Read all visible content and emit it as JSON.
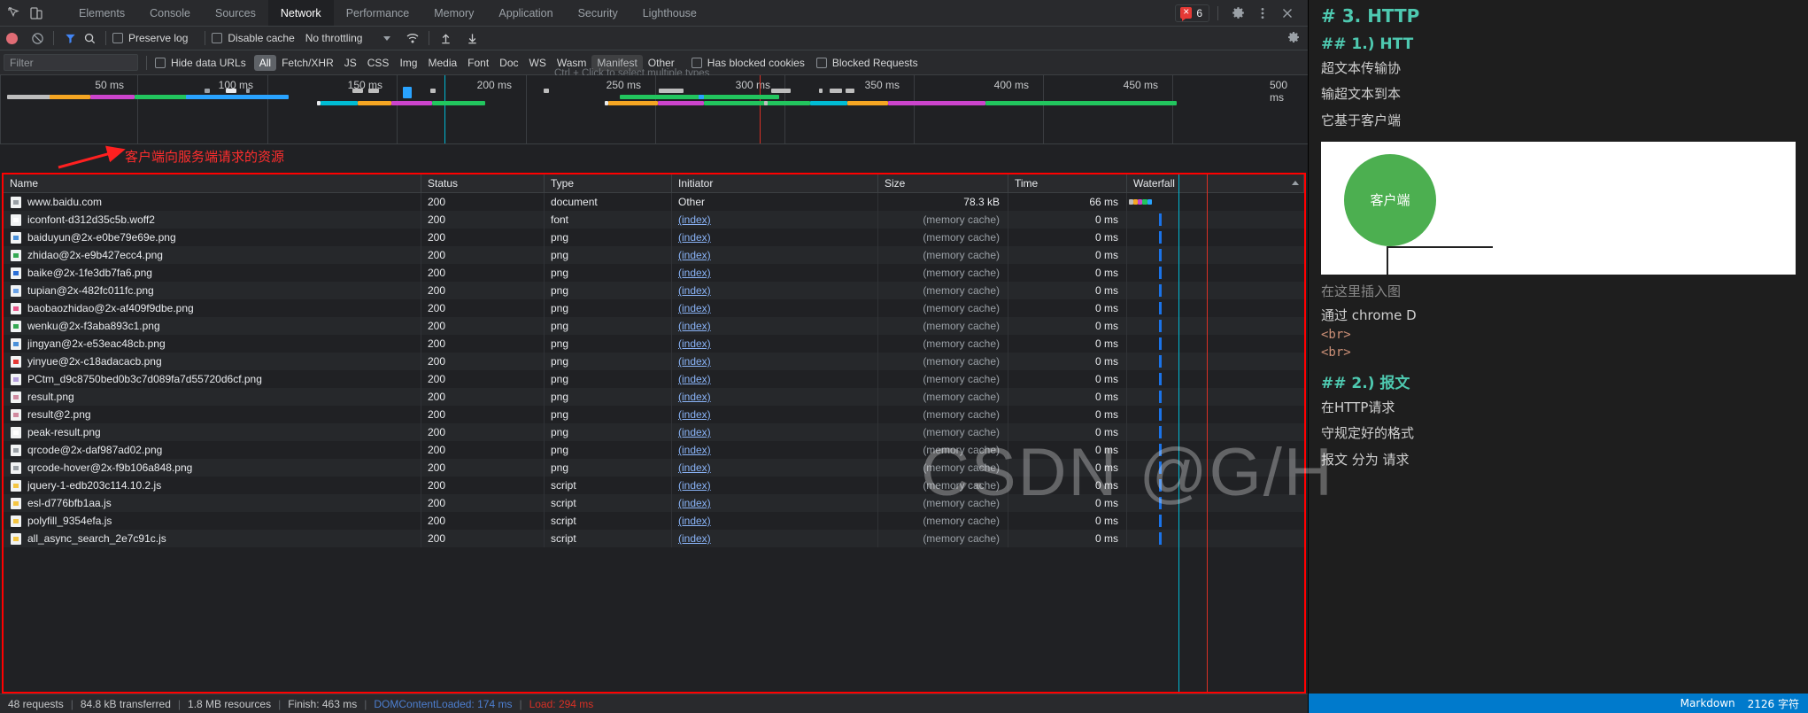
{
  "devtools": {
    "tabs": [
      {
        "label": "Elements",
        "active": false
      },
      {
        "label": "Console",
        "active": false
      },
      {
        "label": "Sources",
        "active": false
      },
      {
        "label": "Network",
        "active": true
      },
      {
        "label": "Performance",
        "active": false
      },
      {
        "label": "Memory",
        "active": false
      },
      {
        "label": "Application",
        "active": false
      },
      {
        "label": "Security",
        "active": false
      },
      {
        "label": "Lighthouse",
        "active": false
      }
    ],
    "error_count": "6",
    "icons": {
      "inspect": "inspect-element-icon",
      "device": "device-toolbar-icon",
      "error": "error-badge-icon",
      "settings": "gear-icon",
      "more": "kebab-menu-icon",
      "close": "close-icon"
    },
    "toolbar": {
      "record_title": "record-button",
      "clear_title": "clear-button",
      "filter_title": "filter-icon",
      "search_title": "search-icon",
      "preserve_log": "Preserve log",
      "disable_cache": "Disable cache",
      "throttling": "No throttling",
      "import_title": "import-har-icon",
      "export_title": "export-har-icon",
      "wifi_title": "network-conditions-icon",
      "settings_title": "network-settings-gear-icon"
    },
    "filterbar": {
      "placeholder": "Filter",
      "filter_value": "",
      "hide_data_urls": "Hide data URLs",
      "types": [
        {
          "label": "All",
          "state": "selected"
        },
        {
          "label": "Fetch/XHR",
          "state": "normal"
        },
        {
          "label": "JS",
          "state": "normal"
        },
        {
          "label": "CSS",
          "state": "normal"
        },
        {
          "label": "Img",
          "state": "normal"
        },
        {
          "label": "Media",
          "state": "normal"
        },
        {
          "label": "Font",
          "state": "normal"
        },
        {
          "label": "Doc",
          "state": "normal"
        },
        {
          "label": "WS",
          "state": "normal"
        },
        {
          "label": "Wasm",
          "state": "normal"
        },
        {
          "label": "Manifest",
          "state": "hover"
        },
        {
          "label": "Other",
          "state": "normal"
        }
      ],
      "has_blocked_cookies": "Has blocked cookies",
      "blocked_requests": "Blocked Requests",
      "tooltip": "Ctrl + Click to select multiple types"
    },
    "overview": {
      "ticks": [
        "50 ms",
        "100 ms",
        "150 ms",
        "200 ms",
        "250 ms",
        "300 ms",
        "350 ms",
        "400 ms",
        "450 ms",
        "500 ms"
      ]
    },
    "annotation": {
      "text": "客户端向服务端请求的资源",
      "color": "#ff2d2d"
    },
    "table": {
      "columns": [
        "Name",
        "Status",
        "Type",
        "Initiator",
        "Size",
        "Time",
        "Waterfall"
      ],
      "rows": [
        {
          "name": "www.baidu.com",
          "icon_color": "#9aa0a6",
          "status": "200",
          "type": "document",
          "initiator": "Other",
          "initiator_link": false,
          "size": "78.3 kB",
          "cached": false,
          "time": "66 ms",
          "wf_start": 2,
          "wf_len": 26,
          "wf_color": "#1a73e8"
        },
        {
          "name": "iconfont-d312d35c5b.woff2",
          "icon_color": "#ffffff",
          "status": "200",
          "type": "font",
          "initiator": "(index)",
          "initiator_link": true,
          "size": "(memory cache)",
          "cached": true,
          "time": "0 ms",
          "wf_start": 36,
          "wf_len": 2,
          "wf_color": "#1a73e8"
        },
        {
          "name": "baiduyun@2x-e0be79e69e.png",
          "icon_color": "#4a90d9",
          "status": "200",
          "type": "png",
          "initiator": "(index)",
          "initiator_link": true,
          "size": "(memory cache)",
          "cached": true,
          "time": "0 ms",
          "wf_start": 36,
          "wf_len": 2,
          "wf_color": "#1a73e8"
        },
        {
          "name": "zhidao@2x-e9b427ecc4.png",
          "icon_color": "#34a853",
          "status": "200",
          "type": "png",
          "initiator": "(index)",
          "initiator_link": true,
          "size": "(memory cache)",
          "cached": true,
          "time": "0 ms",
          "wf_start": 36,
          "wf_len": 2,
          "wf_color": "#1a73e8"
        },
        {
          "name": "baike@2x-1fe3db7fa6.png",
          "icon_color": "#2b6fd6",
          "status": "200",
          "type": "png",
          "initiator": "(index)",
          "initiator_link": true,
          "size": "(memory cache)",
          "cached": true,
          "time": "0 ms",
          "wf_start": 36,
          "wf_len": 2,
          "wf_color": "#1a73e8"
        },
        {
          "name": "tupian@2x-482fc011fc.png",
          "icon_color": "#6ba3e8",
          "status": "200",
          "type": "png",
          "initiator": "(index)",
          "initiator_link": true,
          "size": "(memory cache)",
          "cached": true,
          "time": "0 ms",
          "wf_start": 36,
          "wf_len": 2,
          "wf_color": "#1a73e8"
        },
        {
          "name": "baobaozhidao@2x-af409f9dbe.png",
          "icon_color": "#e8558a",
          "status": "200",
          "type": "png",
          "initiator": "(index)",
          "initiator_link": true,
          "size": "(memory cache)",
          "cached": true,
          "time": "0 ms",
          "wf_start": 36,
          "wf_len": 2,
          "wf_color": "#1a73e8"
        },
        {
          "name": "wenku@2x-f3aba893c1.png",
          "icon_color": "#34a853",
          "status": "200",
          "type": "png",
          "initiator": "(index)",
          "initiator_link": true,
          "size": "(memory cache)",
          "cached": true,
          "time": "0 ms",
          "wf_start": 36,
          "wf_len": 2,
          "wf_color": "#1a73e8"
        },
        {
          "name": "jingyan@2x-e53eac48cb.png",
          "icon_color": "#4a90d9",
          "status": "200",
          "type": "png",
          "initiator": "(index)",
          "initiator_link": true,
          "size": "(memory cache)",
          "cached": true,
          "time": "0 ms",
          "wf_start": 36,
          "wf_len": 2,
          "wf_color": "#1a73e8"
        },
        {
          "name": "yinyue@2x-c18adacacb.png",
          "icon_color": "#e53935",
          "status": "200",
          "type": "png",
          "initiator": "(index)",
          "initiator_link": true,
          "size": "(memory cache)",
          "cached": true,
          "time": "0 ms",
          "wf_start": 36,
          "wf_len": 2,
          "wf_color": "#1a73e8"
        },
        {
          "name": "PCtm_d9c8750bed0b3c7d089fa7d55720d6cf.png",
          "icon_color": "#b39ddb",
          "status": "200",
          "type": "png",
          "initiator": "(index)",
          "initiator_link": true,
          "size": "(memory cache)",
          "cached": true,
          "time": "0 ms",
          "wf_start": 36,
          "wf_len": 2,
          "wf_color": "#1a73e8"
        },
        {
          "name": "result.png",
          "icon_color": "#d08aa0",
          "status": "200",
          "type": "png",
          "initiator": "(index)",
          "initiator_link": true,
          "size": "(memory cache)",
          "cached": true,
          "time": "0 ms",
          "wf_start": 36,
          "wf_len": 2,
          "wf_color": "#1a73e8"
        },
        {
          "name": "result@2.png",
          "icon_color": "#d08aa0",
          "status": "200",
          "type": "png",
          "initiator": "(index)",
          "initiator_link": true,
          "size": "(memory cache)",
          "cached": true,
          "time": "0 ms",
          "wf_start": 36,
          "wf_len": 2,
          "wf_color": "#1a73e8"
        },
        {
          "name": "peak-result.png",
          "icon_color": "#ffffff",
          "status": "200",
          "type": "png",
          "initiator": "(index)",
          "initiator_link": true,
          "size": "(memory cache)",
          "cached": true,
          "time": "0 ms",
          "wf_start": 36,
          "wf_len": 2,
          "wf_color": "#1a73e8"
        },
        {
          "name": "qrcode@2x-daf987ad02.png",
          "icon_color": "#9aa0a6",
          "status": "200",
          "type": "png",
          "initiator": "(index)",
          "initiator_link": true,
          "size": "(memory cache)",
          "cached": true,
          "time": "0 ms",
          "wf_start": 36,
          "wf_len": 2,
          "wf_color": "#1a73e8"
        },
        {
          "name": "qrcode-hover@2x-f9b106a848.png",
          "icon_color": "#9aa0a6",
          "status": "200",
          "type": "png",
          "initiator": "(index)",
          "initiator_link": true,
          "size": "(memory cache)",
          "cached": true,
          "time": "0 ms",
          "wf_start": 36,
          "wf_len": 2,
          "wf_color": "#1a73e8"
        },
        {
          "name": "jquery-1-edb203c114.10.2.js",
          "icon_color": "#f4c542",
          "status": "200",
          "type": "script",
          "initiator": "(index)",
          "initiator_link": true,
          "size": "(memory cache)",
          "cached": true,
          "time": "0 ms",
          "wf_start": 36,
          "wf_len": 2,
          "wf_color": "#1a73e8"
        },
        {
          "name": "esl-d776bfb1aa.js",
          "icon_color": "#f4c542",
          "status": "200",
          "type": "script",
          "initiator": "(index)",
          "initiator_link": true,
          "size": "(memory cache)",
          "cached": true,
          "time": "0 ms",
          "wf_start": 36,
          "wf_len": 2,
          "wf_color": "#1a73e8"
        },
        {
          "name": "polyfill_9354efa.js",
          "icon_color": "#f4c542",
          "status": "200",
          "type": "script",
          "initiator": "(index)",
          "initiator_link": true,
          "size": "(memory cache)",
          "cached": true,
          "time": "0 ms",
          "wf_start": 36,
          "wf_len": 2,
          "wf_color": "#1a73e8"
        },
        {
          "name": "all_async_search_2e7c91c.js",
          "icon_color": "#f4c542",
          "status": "200",
          "type": "script",
          "initiator": "(index)",
          "initiator_link": true,
          "size": "(memory cache)",
          "cached": true,
          "time": "0 ms",
          "wf_start": 36,
          "wf_len": 2,
          "wf_color": "#1a73e8"
        }
      ]
    },
    "statusbar": {
      "requests": "48 requests",
      "transferred": "84.8 kB transferred",
      "resources": "1.8 MB resources",
      "finish": "Finish: 463 ms",
      "dom_content_loaded": "DOMContentLoaded: 174 ms",
      "load": "Load: 294 ms"
    }
  },
  "mdpane": {
    "h1": "# 3. HTTP",
    "h2a": "## 1.) HTT",
    "p1": "超文本传输协",
    "p2": "输超文本到本",
    "p3": "它基于客户端",
    "img_label": "客户端",
    "caption": "在这里插入图",
    "note": "通过 chrome D",
    "br1": "<br>",
    "br2": "<br>",
    "h2b": "## 2.) 报文",
    "p4": "在HTTP请求",
    "p5": "守规定好的格式",
    "p6": "报文 分为 请求",
    "status_mode": "Markdown",
    "status_count": "2126 字符"
  },
  "watermark": "CSDN @G/H"
}
